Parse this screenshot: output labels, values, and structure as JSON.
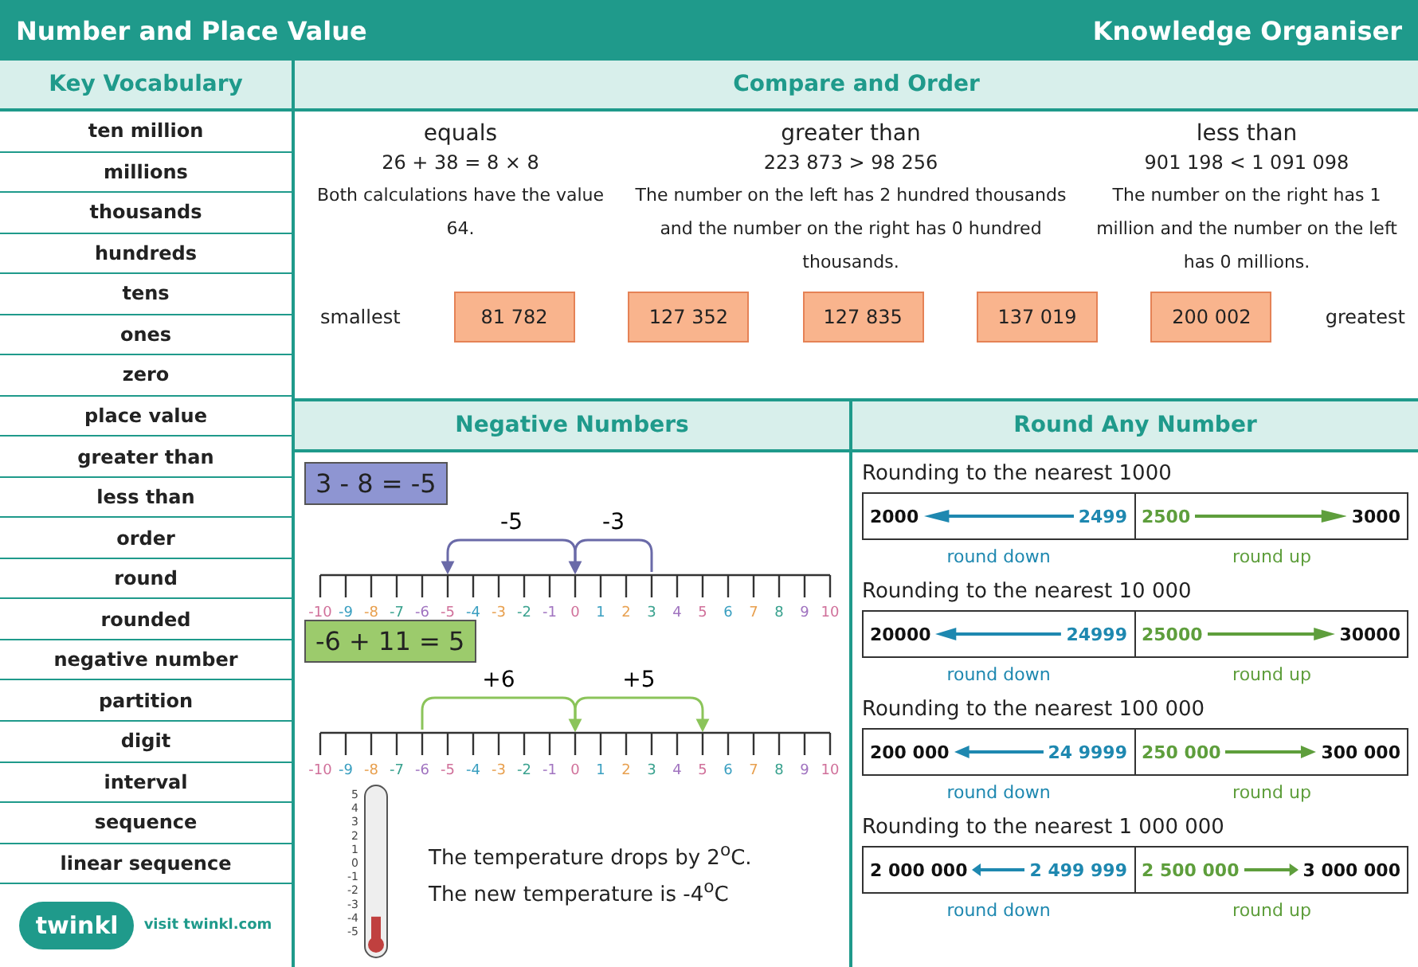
{
  "header": {
    "title": "Number and Place Value",
    "subtitle": "Knowledge Organiser"
  },
  "vocabulary": {
    "title": "Key Vocabulary",
    "items": [
      "ten million",
      "millions",
      "thousands",
      "hundreds",
      "tens",
      "ones",
      "zero",
      "place value",
      "greater than",
      "less than",
      "order",
      "round",
      "rounded",
      "negative number",
      "partition",
      "digit",
      "interval",
      "sequence",
      "linear sequence"
    ]
  },
  "footer": {
    "logo": "twinkl",
    "link": "visit twinkl.com"
  },
  "compare": {
    "title": "Compare and Order",
    "columns": [
      {
        "heading": "equals",
        "example": "26 + 38 = 8 × 8",
        "description": "Both calculations have the value 64."
      },
      {
        "heading": "greater than",
        "example": "223 873 > 98 256",
        "description": "The number on the left has 2 hundred thousands and the number on the right has 0 hundred thousands."
      },
      {
        "heading": "less than",
        "example": "901 198 < 1 091 098",
        "description": "The number on the right has 1 million and the number on the left has 0 millions."
      }
    ],
    "smallest_label": "smallest",
    "greatest_label": "greatest",
    "ordered": [
      "81 782",
      "127 352",
      "127 835",
      "137 019",
      "200 002"
    ]
  },
  "negative": {
    "title": "Negative Numbers",
    "lines": [
      {
        "kind": "subtract",
        "equation": "3 - 8 = -5",
        "jumps": [
          "-5",
          "-3"
        ],
        "ticks": [
          "-10",
          "-9",
          "-8",
          "-7",
          "-6",
          "-5",
          "-4",
          "-3",
          "-2",
          "-1",
          "0",
          "1",
          "2",
          "3",
          "4",
          "5",
          "6",
          "7",
          "8",
          "9",
          "10"
        ]
      },
      {
        "kind": "add",
        "equation": "-6 + 11 = 5",
        "jumps": [
          "+6",
          "+5"
        ],
        "ticks": [
          "-10",
          "-9",
          "-8",
          "-7",
          "-6",
          "-5",
          "-4",
          "-3",
          "-2",
          "-1",
          "0",
          "1",
          "2",
          "3",
          "4",
          "5",
          "6",
          "7",
          "8",
          "9",
          "10"
        ]
      }
    ],
    "thermometer": {
      "scale": [
        "5",
        "4",
        "3",
        "2",
        "1",
        "0",
        "-1",
        "-2",
        "-3",
        "-4",
        "-5"
      ],
      "level": 0.1
    },
    "sentences": [
      "The temperature drops by 2$^{o}$C.",
      "The new temperature is -4$^{o}$C"
    ]
  },
  "rounding": {
    "title": "Round Any Number",
    "rows": [
      {
        "title": "Rounding to the nearest 1000",
        "down_to": "2000",
        "down_from": "2499",
        "up_from": "2500",
        "up_to": "3000",
        "down_label": "round down",
        "up_label": "round up"
      },
      {
        "title": "Rounding to the nearest 10 000",
        "down_to": "20000",
        "down_from": "24999",
        "up_from": "25000",
        "up_to": "30000",
        "down_label": "round down",
        "up_label": "round up"
      },
      {
        "title": "Rounding to the nearest 100 000",
        "down_to": "200 000",
        "down_from": "24 9999",
        "up_from": "250 000",
        "up_to": "300 000",
        "down_label": "round down",
        "up_label": "round up"
      },
      {
        "title": "Rounding to the nearest 1 000 000",
        "down_to": "2 000 000",
        "down_from": "2 499 999",
        "up_from": "2 500 000",
        "up_to": "3 000 000",
        "down_label": "round down",
        "up_label": "round up"
      }
    ]
  }
}
